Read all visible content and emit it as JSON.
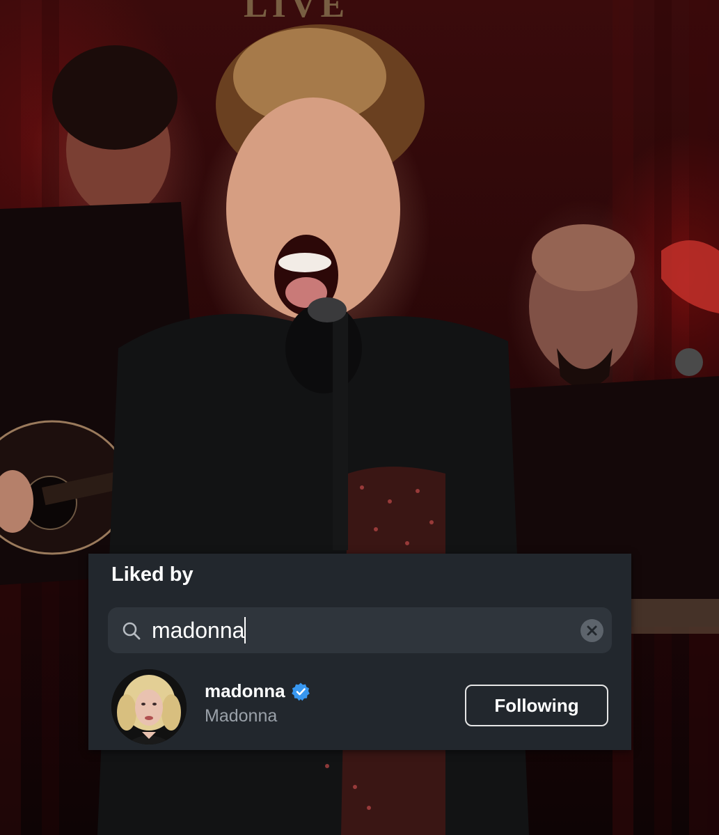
{
  "background": {
    "sign_text": "LIVE"
  },
  "panel": {
    "title": "Liked by",
    "search": {
      "value": "madonna",
      "clear_icon": "close-circle-icon",
      "search_icon": "magnifier-icon"
    },
    "results": [
      {
        "username": "madonna",
        "display_name": "Madonna",
        "verified": true,
        "verified_color": "#3897f0",
        "button_label": "Following"
      }
    ]
  }
}
